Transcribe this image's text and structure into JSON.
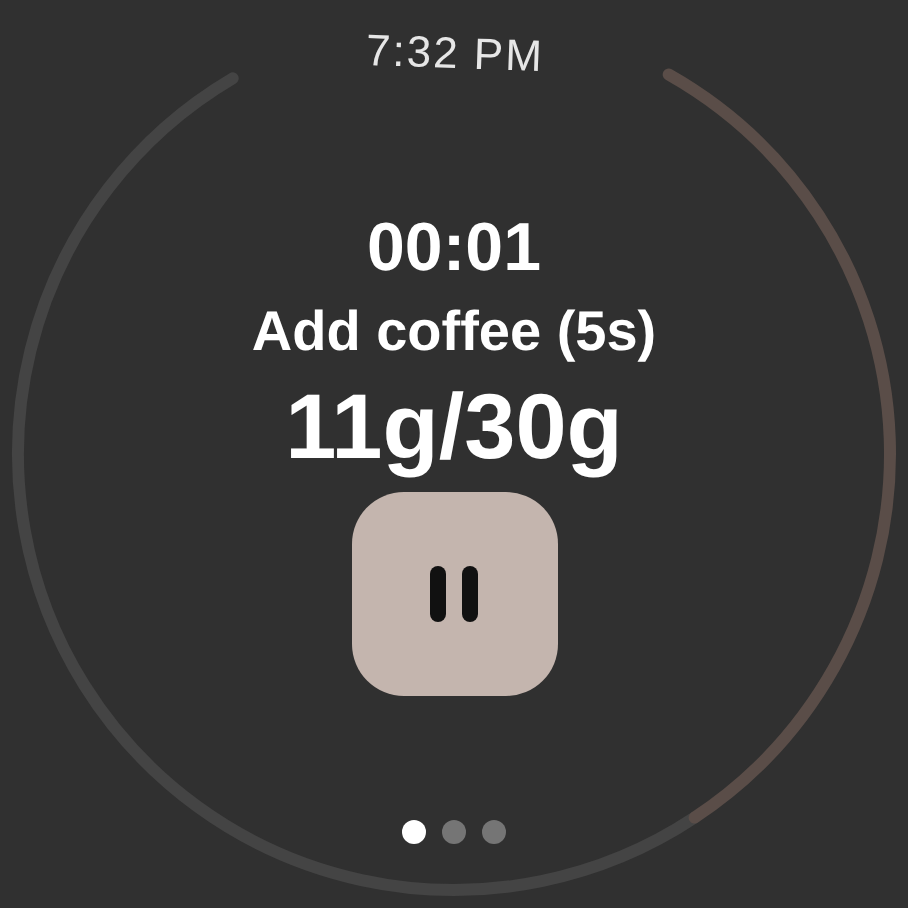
{
  "status": {
    "time": "7:32 PM"
  },
  "timer": {
    "elapsed": "00:01",
    "step": "Add coffee (5s)",
    "weight": "11g/30g"
  },
  "pause_button": {
    "kind": "pause"
  },
  "pages": [
    {
      "selected": true
    },
    {
      "selected": false
    },
    {
      "selected": false
    }
  ]
}
